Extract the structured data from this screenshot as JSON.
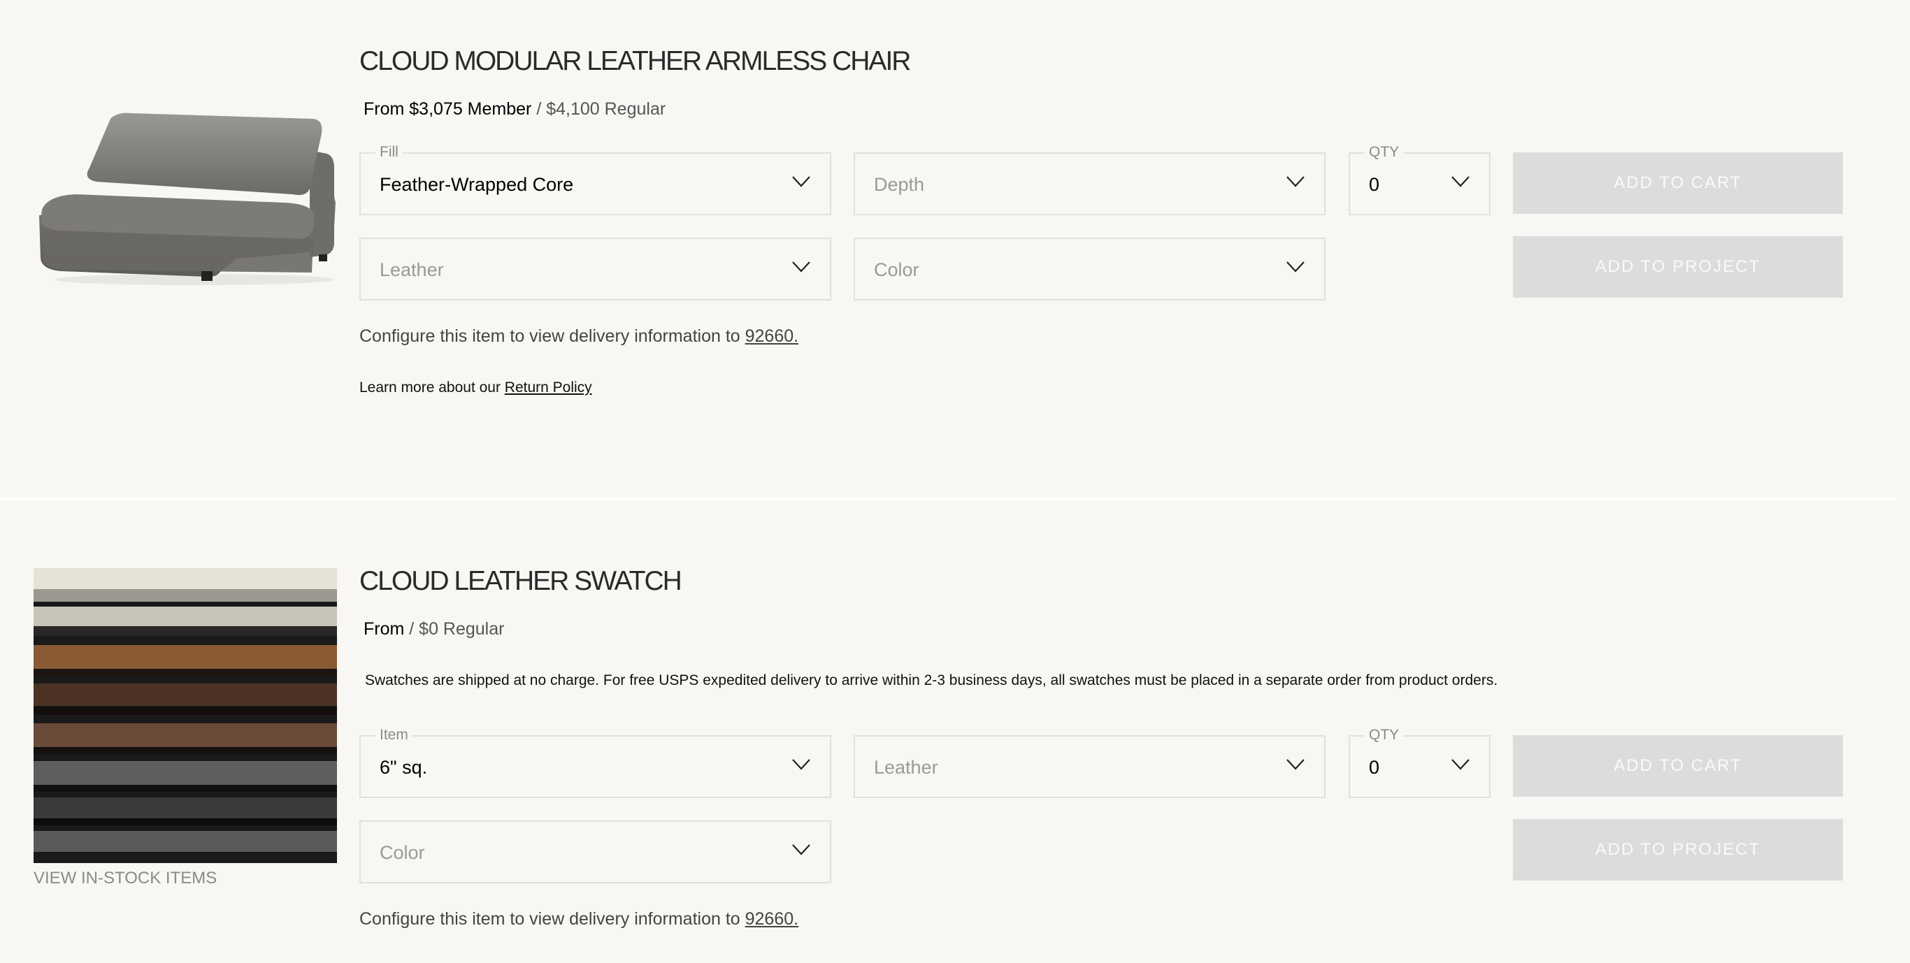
{
  "products": [
    {
      "title": "CLOUD MODULAR LEATHER ARMLESS CHAIR",
      "price_from": "From $3,075 Member",
      "price_regular": " / $4,100 Regular",
      "fields": {
        "fill": {
          "label": "Fill",
          "value": "Feather-Wrapped Core"
        },
        "depth": {
          "placeholder": "Depth"
        },
        "qty": {
          "label": "QTY",
          "value": "0"
        },
        "leather": {
          "placeholder": "Leather"
        },
        "color": {
          "placeholder": "Color"
        }
      },
      "add_to_cart": "ADD TO CART",
      "add_to_project": "ADD TO PROJECT",
      "delivery_text": "Configure this item to view delivery information to ",
      "delivery_zip": "92660.",
      "return_text": "Learn more about our ",
      "return_link": "Return Policy"
    },
    {
      "title": "CLOUD LEATHER SWATCH",
      "price_from": "From",
      "price_regular": " / $0 Regular",
      "swatch_note": "Swatches are shipped at no charge. For free USPS expedited delivery to arrive within 2-3 business days, all swatches must be placed in a separate order from product orders.",
      "fields": {
        "item": {
          "label": "Item",
          "value": "6\" sq."
        },
        "leather": {
          "placeholder": "Leather"
        },
        "qty": {
          "label": "QTY",
          "value": "0"
        },
        "color": {
          "placeholder": "Color"
        }
      },
      "add_to_cart": "ADD TO CART",
      "add_to_project": "ADD TO PROJECT",
      "view_in_stock": "VIEW IN-STOCK ITEMS",
      "delivery_text": "Configure this item to view delivery information to ",
      "delivery_zip": "92660."
    }
  ],
  "icons": {
    "dropdown": "chevron-down-icon"
  },
  "colors": {
    "background": "#f8f7f4",
    "button_disabled": "#dcdcdc",
    "border": "#e2e0dc"
  }
}
